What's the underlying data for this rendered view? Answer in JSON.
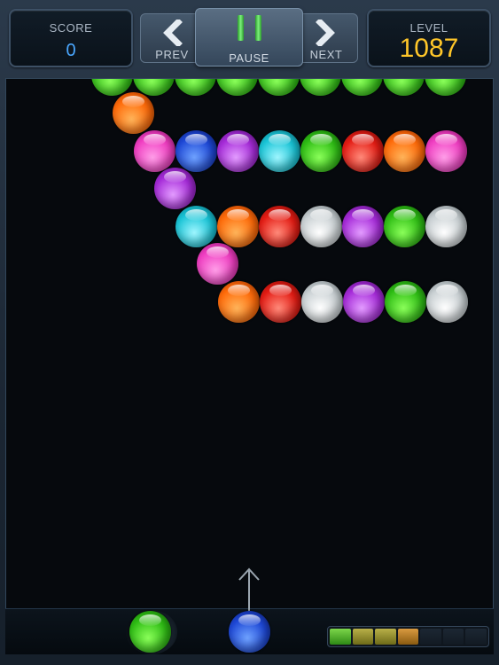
{
  "header": {
    "score_label": "SCORE",
    "score_value": "0",
    "level_label": "LEVEL",
    "level_value": "1087",
    "prev_label": "PREV",
    "pause_label": "PAUSE",
    "next_label": "NEXT"
  },
  "colors": {
    "score_value": "#4aa7ff",
    "level_value": "#ffc629",
    "pause_icon": "#4fd84f",
    "bubble_palette": [
      "green",
      "orange",
      "pink",
      "blue",
      "purple",
      "cyan",
      "red",
      "white"
    ]
  },
  "icons": {
    "prev": "chevron-left-icon",
    "next": "chevron-right-icon",
    "pause": "pause-icon",
    "aim": "arrow-up-icon"
  },
  "board": {
    "rows": [
      [
        "green",
        "green",
        "green",
        "green",
        "green",
        "green",
        "green",
        "green",
        "green"
      ],
      [
        "orange"
      ],
      [
        "pink",
        "blue",
        "purple",
        "cyan",
        "green",
        "red",
        "orange",
        "pink"
      ],
      [
        "purple"
      ],
      [
        "cyan",
        "orange",
        "red",
        "white",
        "purple",
        "green",
        "white"
      ],
      [
        "pink"
      ],
      [
        "orange",
        "red",
        "white",
        "purple",
        "green",
        "white"
      ]
    ]
  },
  "launcher": {
    "loaded_bubble": "blue",
    "next_bubble": "green"
  },
  "progress_meter": {
    "segments_total": 7,
    "segments_filled": 4
  }
}
